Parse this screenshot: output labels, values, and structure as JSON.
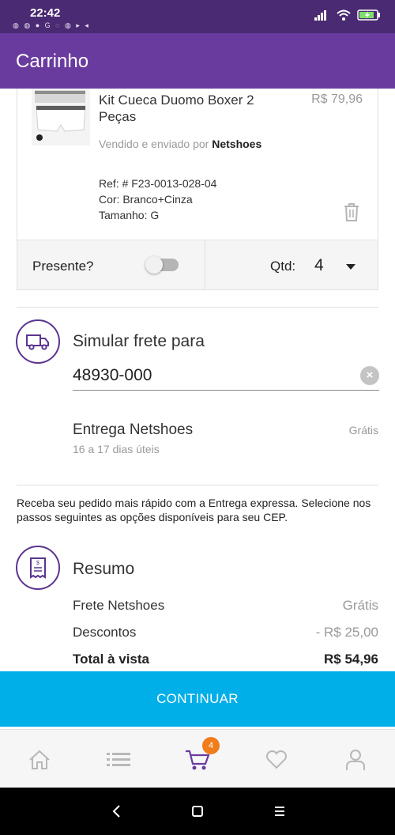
{
  "status_bar": {
    "time": "22:42",
    "notifications": "◍ ◍ ● G ◌ ◍ ▸ ◂"
  },
  "app_bar": {
    "title": "Carrinho"
  },
  "product": {
    "name": "Kit Cueca Duomo Boxer 2 Peças",
    "price": "R$ 79,96",
    "seller_prefix": "Vendido e enviado por",
    "seller_name": "Netshoes",
    "ref": "Ref: # F23-0013-028-04",
    "color": "Cor: Branco+Cinza",
    "size": "Tamanho: G",
    "gift_label": "Presente?",
    "qty_label": "Qtd:",
    "qty_value": "4"
  },
  "shipping": {
    "title": "Simular frete para",
    "cep_value": "48930-000",
    "option_name": "Entrega Netshoes",
    "option_price": "Grátis",
    "option_time": "16 a 17 dias úteis",
    "express_note": "Receba seu pedido mais rápido com a Entrega expressa. Selecione nos passos seguintes as opções disponíveis para seu CEP."
  },
  "summary": {
    "title": "Resumo",
    "rows": [
      {
        "label": "Frete Netshoes",
        "value": "Grátis"
      },
      {
        "label": "Descontos",
        "value": "- R$ 25,00"
      },
      {
        "label": "Total à vista",
        "value": "R$ 54,96"
      }
    ]
  },
  "continue_label": "CONTINUAR",
  "bottom_nav": {
    "cart_badge": "4"
  },
  "colors": {
    "app_bar": "#6a3b9f",
    "status_bar": "#4a2a72",
    "accent_purple": "#5b3490",
    "button": "#00aee8",
    "badge": "#f07d1a"
  },
  "icons": [
    "truck-icon",
    "receipt-icon",
    "trash-icon",
    "home-icon",
    "list-icon",
    "cart-icon",
    "heart-icon",
    "profile-icon",
    "close-icon",
    "wifi-icon",
    "battery-icon",
    "signal-icon"
  ]
}
